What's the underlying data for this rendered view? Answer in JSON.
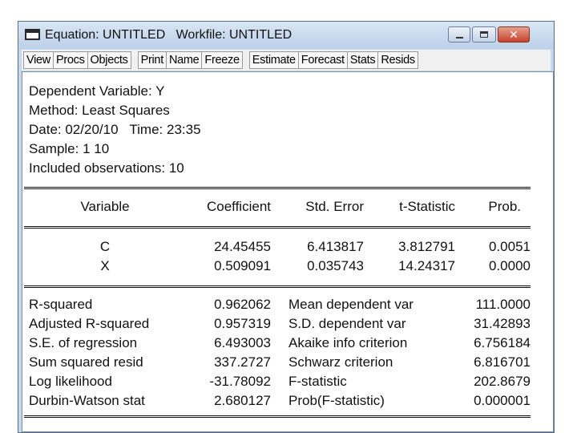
{
  "window": {
    "title": "Equation: UNTITLED   Workfile: UNTITLED",
    "minimize_glyph": "minimize-icon",
    "maximize_glyph": "maximize-icon",
    "close_glyph": "✕"
  },
  "toolbar": {
    "groups": [
      [
        "View",
        "Procs",
        "Objects"
      ],
      [
        "Print",
        "Name",
        "Freeze"
      ],
      [
        "Estimate",
        "Forecast",
        "Stats",
        "Resids"
      ]
    ]
  },
  "header": {
    "dependent": "Dependent Variable: Y",
    "method": "Method: Least Squares",
    "date": "Date: 02/20/10   Time: 23:35",
    "sample": "Sample: 1 10",
    "observations": "Included observations: 10"
  },
  "coef_table": {
    "columns": [
      "Variable",
      "Coefficient",
      "Std. Error",
      "t-Statistic",
      "Prob."
    ],
    "rows": [
      [
        "C",
        "24.45455",
        "6.413817",
        "3.812791",
        "0.0051"
      ],
      [
        "X",
        "0.509091",
        "0.035743",
        "14.24317",
        "0.0000"
      ]
    ]
  },
  "stats": {
    "rows": [
      [
        "R-squared",
        "0.962062",
        "Mean dependent var",
        "111.0000"
      ],
      [
        "Adjusted R-squared",
        "0.957319",
        "S.D. dependent var",
        "31.42893"
      ],
      [
        "S.E. of regression",
        "6.493003",
        "Akaike info criterion",
        "6.756184"
      ],
      [
        "Sum squared resid",
        "337.2727",
        "Schwarz criterion",
        "6.816701"
      ],
      [
        "Log likelihood",
        "-31.78092",
        "F-statistic",
        "202.8679"
      ],
      [
        "Durbin-Watson stat",
        "2.680127",
        "Prob(F-statistic)",
        "0.000001"
      ]
    ]
  }
}
